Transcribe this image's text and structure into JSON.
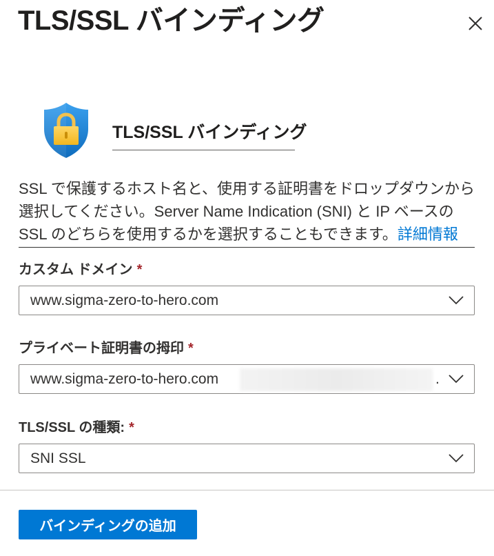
{
  "panel": {
    "title": "TLS/SSL バインディング",
    "close_icon": "close-icon"
  },
  "intro": {
    "icon": "shield-lock-icon",
    "heading": "TLS/SSL バインディング",
    "description": "SSL で保護するホスト名と、使用する証明書をドロップダウンから選択してください。Server Name Indication (SNI) と IP ベースの SSL のどちらを使用するかを選択することもできます。",
    "learn_more": "詳細情報"
  },
  "fields": {
    "custom_domain": {
      "label": "カスタム ドメイン",
      "required": "*",
      "value": "www.sigma-zero-to-hero.com"
    },
    "private_cert_thumbprint": {
      "label": "プライベート証明書の拇印",
      "required": "*",
      "value": "www.sigma-zero-to-hero.com",
      "suffix": "."
    },
    "tls_ssl_type": {
      "label": "TLS/SSL の種類:",
      "required": "*",
      "value": "SNI SSL"
    }
  },
  "actions": {
    "add_binding": "バインディングの追加"
  },
  "colors": {
    "accent": "#0078d4",
    "required": "#a4262c",
    "text": "#201f1e",
    "border": "#8a8886",
    "shield_blue": "#1a8de0",
    "lock_yellow": "#f7c531"
  }
}
